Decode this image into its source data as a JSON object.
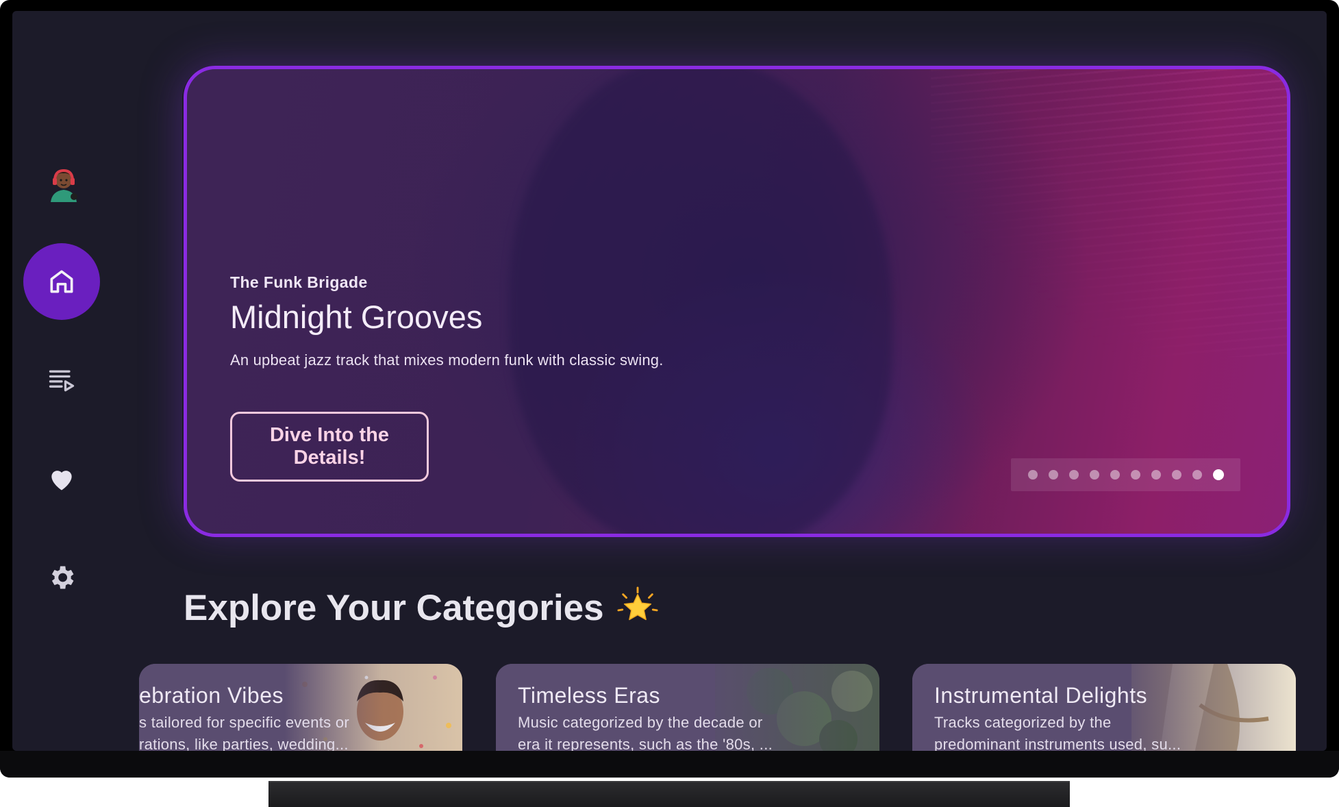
{
  "sidebar": {
    "items": [
      {
        "name": "home",
        "icon": "home-icon",
        "active": true
      },
      {
        "name": "playlist",
        "icon": "playlist-play-icon",
        "active": false
      },
      {
        "name": "favorites",
        "icon": "heart-icon",
        "active": false
      },
      {
        "name": "settings",
        "icon": "gear-icon",
        "active": false
      }
    ],
    "active_color": "#6a1fbf"
  },
  "hero": {
    "artist": "The Funk Brigade",
    "title": "Midnight Grooves",
    "description": "An upbeat jazz track that mixes modern funk with classic swing.",
    "button_label": "Dive Into the Details!",
    "slides_total": 10,
    "active_slide": 10,
    "border_color": "#8a2be2"
  },
  "section": {
    "title": "Explore Your Categories",
    "emoji": "star-icon"
  },
  "categories": [
    {
      "title": "ebration Vibes",
      "line1": "s tailored for specific events or",
      "line2": "rations, like parties, wedding..."
    },
    {
      "title": "Timeless Eras",
      "line1": "Music categorized by the decade or",
      "line2": "era it represents, such as the '80s, ..."
    },
    {
      "title": "Instrumental Delights",
      "line1": "Tracks categorized by the",
      "line2": "predominant instruments used, su..."
    }
  ]
}
